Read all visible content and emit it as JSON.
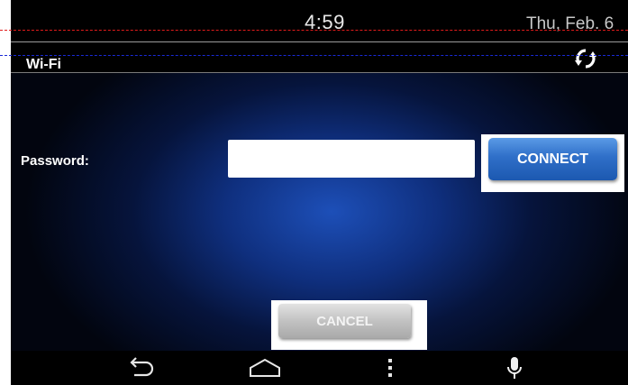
{
  "statusbar": {
    "time": "4:59",
    "date": "Thu, Feb. 6"
  },
  "titlebar": {
    "title": "Wi-Fi",
    "refresh_icon": "refresh-icon"
  },
  "form": {
    "password_label": "Password:",
    "password_value": "",
    "password_placeholder": "",
    "connect_label": "CONNECT",
    "cancel_label": "CANCEL"
  },
  "navbar": {
    "icons": [
      "back-icon",
      "home-icon",
      "menu-icon",
      "microphone-icon"
    ]
  },
  "colors": {
    "accent": "#2f6fc8",
    "background": "#06143c",
    "guide_red": "#e11b1b",
    "guide_blue": "#1a2ad8"
  }
}
